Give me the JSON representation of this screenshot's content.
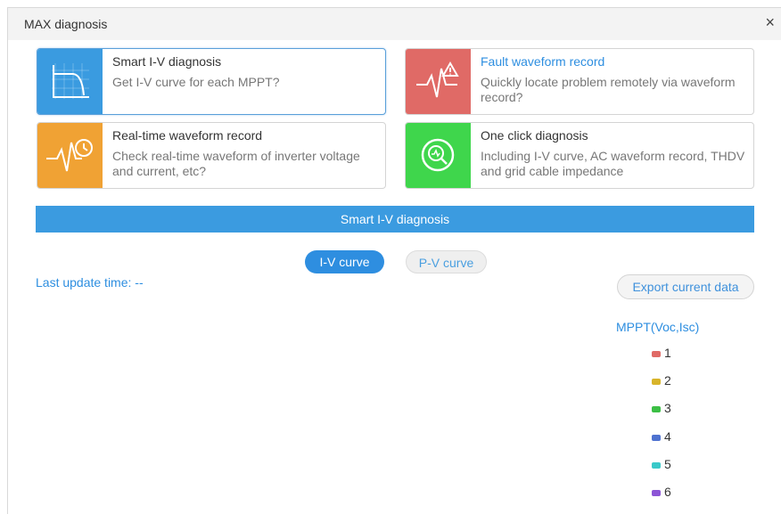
{
  "dialog": {
    "title": "MAX diagnosis",
    "close": "×"
  },
  "cards": [
    {
      "title": "Smart I-V diagnosis",
      "desc": "Get I-V curve for each MPPT?",
      "color": "#3a9be0"
    },
    {
      "title": "Fault waveform record",
      "desc": "Quickly locate problem remotely via waveform record?",
      "color": "#e06a66"
    },
    {
      "title": "Real-time waveform record",
      "desc": "Check real-time waveform of inverter voltage and current, etc?",
      "color": "#f0a234"
    },
    {
      "title": "One click diagnosis",
      "desc": "Including I-V curve, AC waveform record, THDV and grid cable impedance",
      "color": "#3fd64c"
    }
  ],
  "banner": "Smart I-V diagnosis",
  "tabs": {
    "iv": "I-V curve",
    "pv": "P-V curve"
  },
  "last_update": "Last update time:  --",
  "export": "Export current data",
  "legend": {
    "title": "MPPT(Voc,Isc)",
    "items": [
      {
        "label": "1",
        "color": "#e06a66"
      },
      {
        "label": "2",
        "color": "#d8b42a"
      },
      {
        "label": "3",
        "color": "#3cbf45"
      },
      {
        "label": "4",
        "color": "#4e72d0"
      },
      {
        "label": "5",
        "color": "#39c9c9"
      },
      {
        "label": "6",
        "color": "#8c55d6"
      }
    ]
  }
}
